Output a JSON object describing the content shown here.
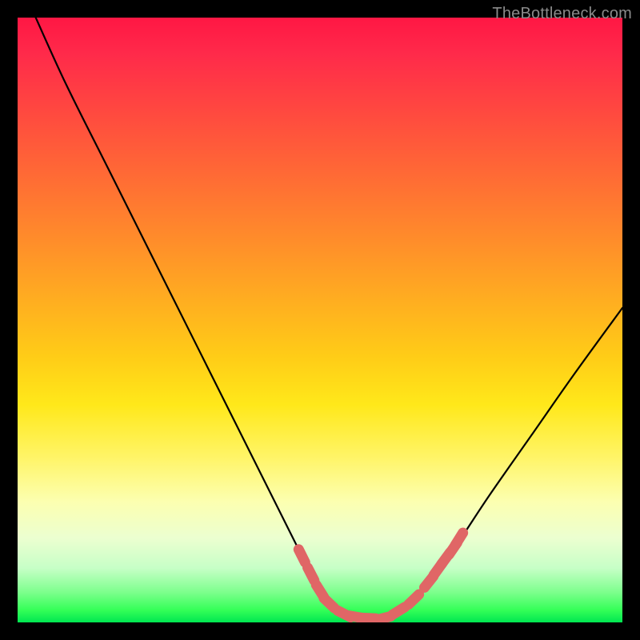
{
  "watermark": "TheBottleneck.com",
  "chart_data": {
    "type": "line",
    "title": "",
    "xlabel": "",
    "ylabel": "",
    "xlim": [
      0,
      100
    ],
    "ylim": [
      0,
      100
    ],
    "series": [
      {
        "name": "curve",
        "x": [
          3,
          8,
          15,
          22,
          29,
          36,
          41,
          45,
          48,
          50,
          52,
          54,
          56,
          59,
          62,
          65,
          68,
          72,
          78,
          85,
          92,
          100
        ],
        "y": [
          100,
          89,
          75,
          61,
          47,
          33,
          23,
          15,
          9,
          5,
          2.5,
          1.2,
          0.6,
          0.6,
          1.5,
          3.5,
          7,
          12,
          21,
          31,
          41,
          52
        ]
      }
    ],
    "markers": {
      "name": "highlight-dots",
      "color": "#e06666",
      "x": [
        47.0,
        48.5,
        50.0,
        51.5,
        54.0,
        56.0,
        58.0,
        60.5,
        63.0,
        65.5,
        68.0,
        69.5,
        70.8,
        72.0,
        73.0
      ],
      "y": [
        11.0,
        8.0,
        5.2,
        3.2,
        1.4,
        0.9,
        0.7,
        0.7,
        1.9,
        3.8,
        6.7,
        8.8,
        10.6,
        12.2,
        13.8
      ]
    },
    "gradient_stops": [
      {
        "pos": 0,
        "color": "#ff1744"
      },
      {
        "pos": 50,
        "color": "#ffd400"
      },
      {
        "pos": 100,
        "color": "#00e651"
      }
    ]
  }
}
